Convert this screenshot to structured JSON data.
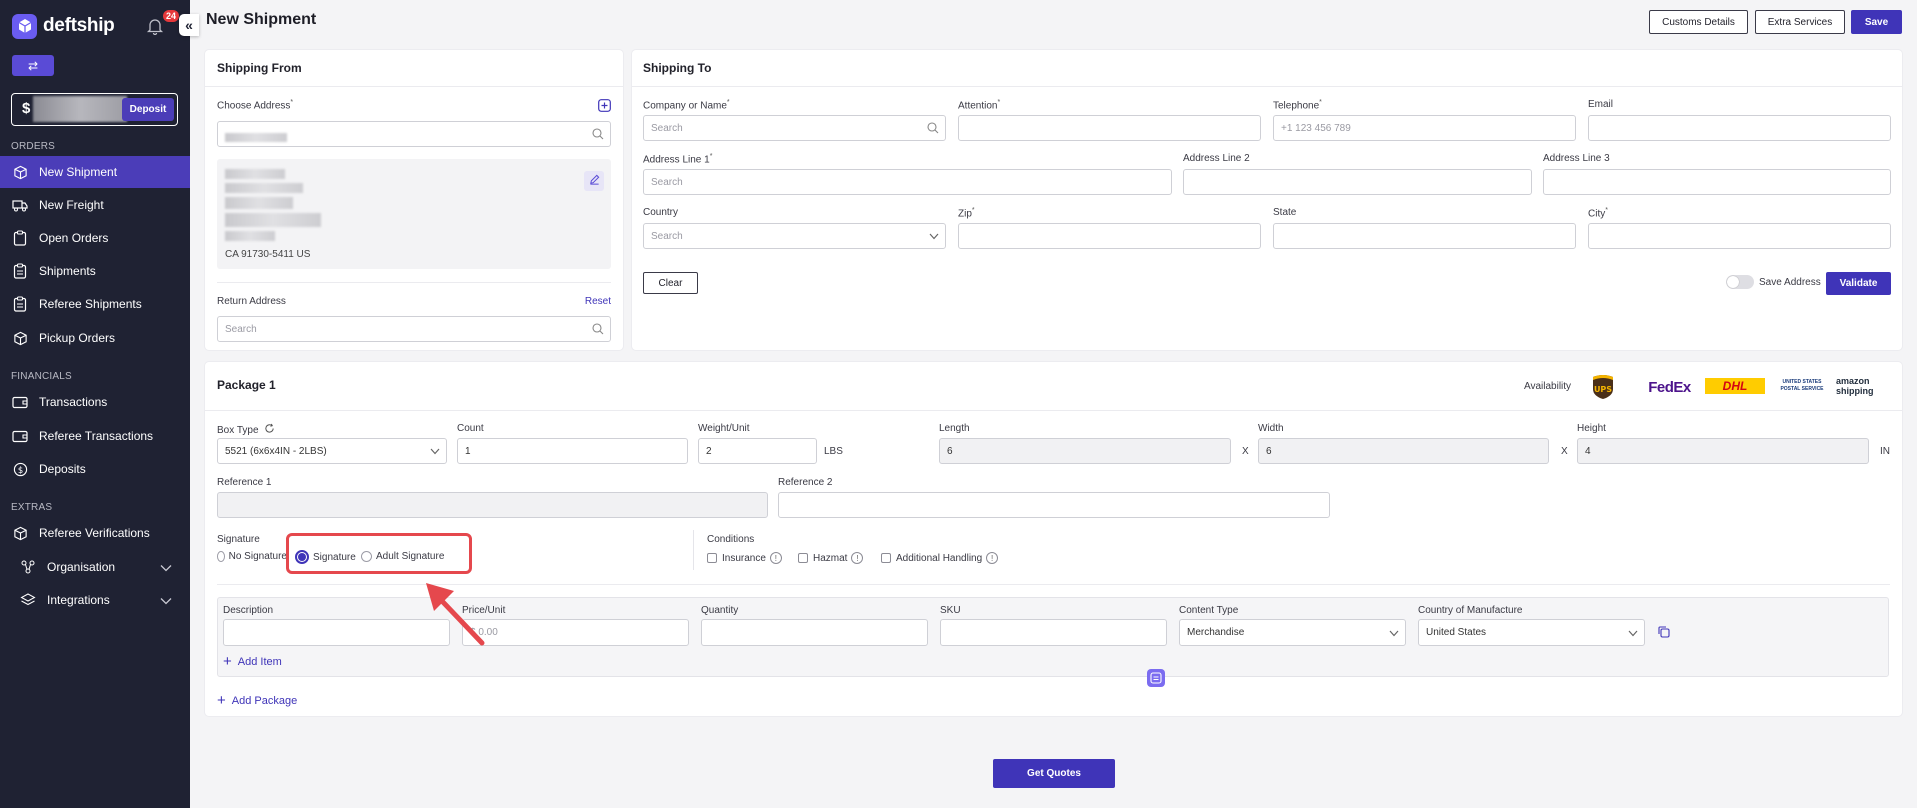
{
  "brand": {
    "name": "deftship",
    "accent": "#3f34b8",
    "sidebar_bg": "#1f2233"
  },
  "notifications": {
    "count": "24"
  },
  "balance": {
    "currency": "$",
    "deposit_label": "Deposit"
  },
  "sidebar": {
    "sections": {
      "orders": "ORDERS",
      "financials": "FINANCIALS",
      "extras": "EXTRAS"
    },
    "items": [
      {
        "label": "New Shipment",
        "icon": "box-icon"
      },
      {
        "label": "New Freight",
        "icon": "truck-icon"
      },
      {
        "label": "Open Orders",
        "icon": "clipboard-icon"
      },
      {
        "label": "Shipments",
        "icon": "clipboard-list-icon"
      },
      {
        "label": "Referee Shipments",
        "icon": "clipboard-list-icon"
      },
      {
        "label": "Pickup Orders",
        "icon": "box-icon"
      },
      {
        "label": "Transactions",
        "icon": "wallet-icon"
      },
      {
        "label": "Referee Transactions",
        "icon": "wallet-icon"
      },
      {
        "label": "Deposits",
        "icon": "dollar-icon"
      },
      {
        "label": "Referee Verifications",
        "icon": "box-icon"
      },
      {
        "label": "Organisation",
        "icon": "org-icon"
      },
      {
        "label": "Integrations",
        "icon": "layers-icon"
      }
    ]
  },
  "header": {
    "title": "New Shipment",
    "customs_label": "Customs Details",
    "extra_label": "Extra Services",
    "save_label": "Save"
  },
  "shipping_from": {
    "title": "Shipping From",
    "choose_label": "Choose Address",
    "address_tail": "CA 91730-5411 US",
    "return_label": "Return Address",
    "reset_label": "Reset",
    "return_placeholder": "Search"
  },
  "shipping_to": {
    "title": "Shipping To",
    "company_label": "Company or Name",
    "company_placeholder": "Search",
    "attention_label": "Attention",
    "telephone_label": "Telephone",
    "telephone_placeholder": "+1 123 456 789",
    "email_label": "Email",
    "addr1_label": "Address Line 1",
    "addr1_placeholder": "Search",
    "addr2_label": "Address Line 2",
    "addr3_label": "Address Line 3",
    "country_label": "Country",
    "country_placeholder": "Search",
    "zip_label": "Zip",
    "state_label": "State",
    "city_label": "City",
    "clear_label": "Clear",
    "save_address_label": "Save Address",
    "validate_label": "Validate"
  },
  "package": {
    "title": "Package 1",
    "availability_label": "Availability",
    "carriers": [
      "UPS",
      "FedEx",
      "DHL",
      "UNITED STATES POSTAL SERVICE",
      "amazon shipping"
    ],
    "box_type_label": "Box Type",
    "box_type_value": "5521 (6x6x4IN - 2LBS)",
    "count_label": "Count",
    "count_value": "1",
    "weight_label": "Weight/Unit",
    "weight_value": "2",
    "weight_unit": "LBS",
    "length_label": "Length",
    "length_value": "6",
    "width_label": "Width",
    "width_value": "6",
    "height_label": "Height",
    "height_value": "4",
    "dim_unit": "IN",
    "times": "X",
    "ref1_label": "Reference 1",
    "ref2_label": "Reference 2",
    "signature_label": "Signature",
    "signature_options": [
      "No Signature",
      "Signature",
      "Adult Signature"
    ],
    "signature_selected": "Signature",
    "conditions_label": "Conditions",
    "conditions": [
      "Insurance",
      "Hazmat",
      "Additional Handling"
    ],
    "item": {
      "description_label": "Description",
      "price_label": "Price/Unit",
      "price_placeholder": "$ 0.00",
      "quantity_label": "Quantity",
      "sku_label": "SKU",
      "content_type_label": "Content Type",
      "content_type_value": "Merchandise",
      "country_label": "Country of Manufacture",
      "country_value": "United States"
    },
    "add_item_label": "Add Item",
    "add_package_label": "Add Package"
  },
  "get_quotes_label": "Get Quotes"
}
